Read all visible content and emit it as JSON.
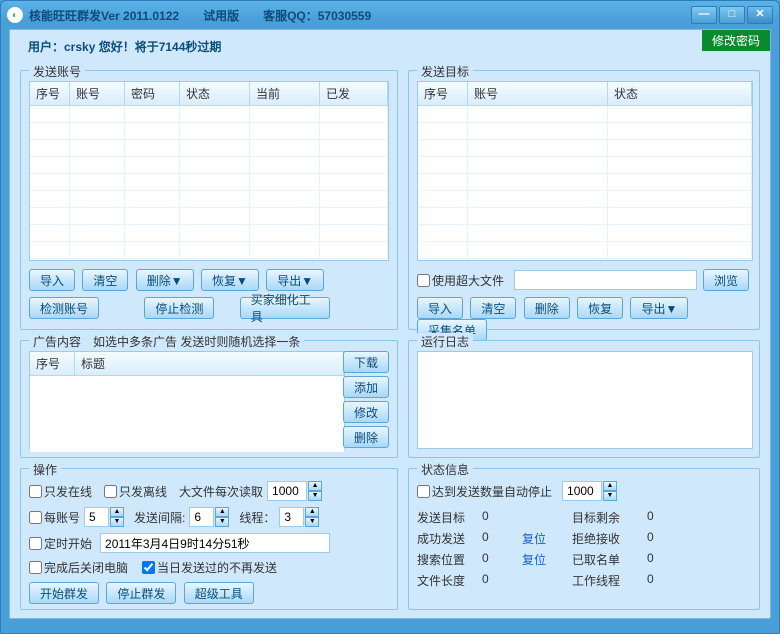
{
  "title": "核能旺旺群发Ver 2011.0122　　试用版　　客服QQ：57030559",
  "user_line": "用户：crsky 您好！将于7144秒过期",
  "change_pw": "修改密码",
  "groups": {
    "send_accounts": {
      "title": "发送账号",
      "cols": [
        "序号",
        "账号",
        "密码",
        "状态",
        "当前",
        "已发"
      ],
      "btns": {
        "imp": "导入",
        "clr": "清空",
        "del": "删除▼",
        "rec": "恢复▼",
        "exp": "导出▼",
        "chk": "检测账号",
        "stop": "停止检测",
        "tool": "买家细化工具"
      }
    },
    "send_targets": {
      "title": "发送目标",
      "cols": [
        "序号",
        "账号",
        "状态"
      ],
      "bigfile_chk": "使用超大文件",
      "browse": "浏览",
      "btns": {
        "imp": "导入",
        "clr": "清空",
        "del": "删除",
        "rec": "恢复",
        "exp": "导出▼",
        "coll": "采集名单"
      }
    },
    "ads": {
      "title": "广告内容　如选中多条广告 发送时则随机选择一条",
      "cols": [
        "序号",
        "标题"
      ],
      "btns": {
        "dl": "下载",
        "add": "添加",
        "mod": "修改",
        "del": "删除"
      }
    },
    "log": {
      "title": "运行日志"
    },
    "ops": {
      "title": "操作",
      "only_online": "只发在线",
      "only_offline": "只发离线",
      "big_read": "大文件每次读取",
      "big_read_v": "1000",
      "per_acc": "每账号",
      "per_acc_v": "5",
      "interval": "发送间隔:",
      "interval_v": "6",
      "threads": "线程：",
      "threads_v": "3",
      "sched": "定时开始",
      "sched_v": "2011年3月4日9时14分51秒",
      "shutdown": "完成后关闭电脑",
      "no_repeat": "当日发送过的不再发送",
      "start": "开始群发",
      "stop": "停止群发",
      "super": "超级工具"
    },
    "status": {
      "title": "状态信息",
      "stop_at": "达到发送数量自动停止",
      "stop_v": "1000",
      "rows": [
        {
          "k1": "发送目标",
          "v1": "0",
          "mid": "",
          "k2": "目标剩余",
          "v2": "0"
        },
        {
          "k1": "成功发送",
          "v1": "0",
          "mid": "复位",
          "k2": "拒绝接收",
          "v2": "0"
        },
        {
          "k1": "搜索位置",
          "v1": "0",
          "mid": "复位",
          "k2": "已取名单",
          "v2": "0"
        },
        {
          "k1": "文件长度",
          "v1": "0",
          "mid": "",
          "k2": "工作线程",
          "v2": "0"
        }
      ]
    }
  }
}
